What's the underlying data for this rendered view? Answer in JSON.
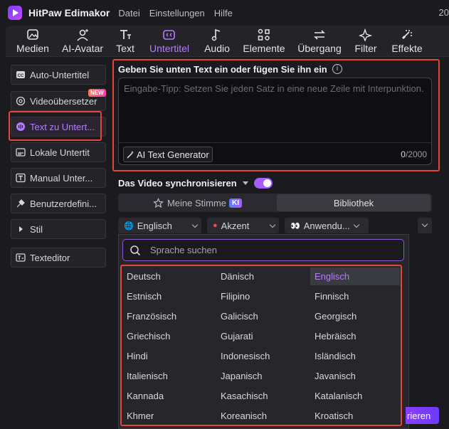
{
  "titlebar": {
    "app_name": "HitPaw Edimakor",
    "menu": [
      "Datei",
      "Einstellungen",
      "Hilfe"
    ],
    "right_text": "20"
  },
  "toolbar": {
    "tools": [
      {
        "label": "Medien",
        "icon": "media-icon"
      },
      {
        "label": "AI-Avatar",
        "icon": "avatar-icon"
      },
      {
        "label": "Text",
        "icon": "text-icon"
      },
      {
        "label": "Untertitel",
        "icon": "subtitle-icon",
        "active": true
      },
      {
        "label": "Audio",
        "icon": "music-note-icon"
      },
      {
        "label": "Elemente",
        "icon": "elements-icon"
      },
      {
        "label": "Übergang",
        "icon": "transition-icon"
      },
      {
        "label": "Filter",
        "icon": "sparkle-icon"
      },
      {
        "label": "Effekte",
        "icon": "effects-icon"
      }
    ]
  },
  "sidebar": {
    "items": [
      {
        "label": "Auto-Untertitel",
        "icon": "cc-icon"
      },
      {
        "label": "Videoübersetzer",
        "icon": "translate-icon",
        "badge": "NEW"
      },
      {
        "label": "Text zu Untert...",
        "icon": "voice-icon",
        "active": true
      },
      {
        "label": "Lokale Untertit",
        "icon": "local-subtitle-icon"
      },
      {
        "label": "Manual Unter...",
        "icon": "manual-subtitle-icon"
      },
      {
        "label": "Benutzerdefini...",
        "icon": "custom-icon"
      },
      {
        "label": "Stil",
        "icon": "triangle-right-icon"
      },
      {
        "label": "Texteditor",
        "icon": "text-editor-icon"
      }
    ]
  },
  "main": {
    "heading": "Geben Sie unten Text ein oder fügen Sie ihn ein",
    "info": "i",
    "textarea_placeholder": "Eingabe-Tipp: Setzen Sie jeden Satz in eine neue Zeile mit Interpunktion.",
    "ai_button": "AI Text Generator",
    "counter_current": "0",
    "counter_max": "/2000",
    "sync_label": "Das Video synchronisieren",
    "tabs": {
      "my_voice": "Meine Stimme",
      "ki_badge": "KI",
      "library": "Bibliothek"
    },
    "options": {
      "language": "Englisch",
      "accent": "Akzent",
      "usage": "Anwendu..."
    }
  },
  "dropdown": {
    "search_placeholder": "Sprache suchen",
    "selected": "Englisch",
    "languages": [
      [
        "Deutsch",
        "Dänisch",
        "Englisch"
      ],
      [
        "Estnisch",
        "Filipino",
        "Finnisch"
      ],
      [
        "Französisch",
        "Galicisch",
        "Georgisch"
      ],
      [
        "Griechisch",
        "Gujarati",
        "Hebräisch"
      ],
      [
        "Hindi",
        "Indonesisch",
        "Isländisch"
      ],
      [
        "Italienisch",
        "Japanisch",
        "Javanisch"
      ],
      [
        "Kannada",
        "Kasachisch",
        "Katalanisch"
      ],
      [
        "Khmer",
        "Koreanisch",
        "Kroatisch"
      ]
    ]
  },
  "render_button": "rieren",
  "colors": {
    "accent": "#b67cff",
    "highlight": "#e5463c"
  }
}
